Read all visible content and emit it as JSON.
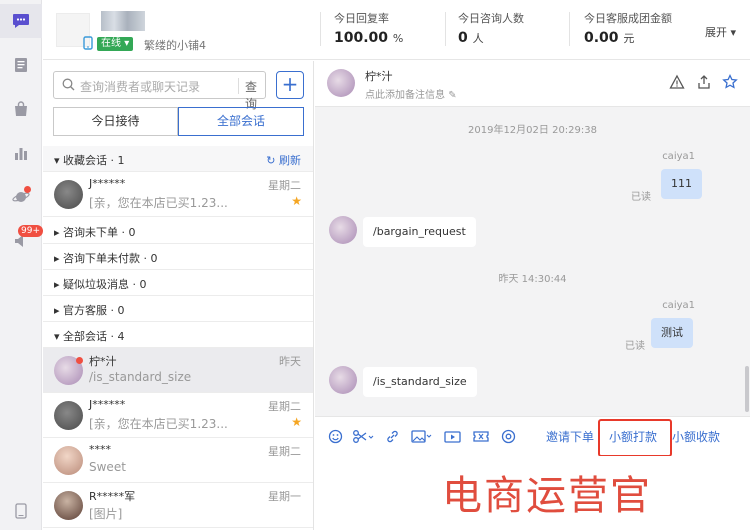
{
  "sidebar": {
    "badge_count": "99+"
  },
  "topbar": {
    "status": "在线",
    "shop_name": "繁缕的小铺4",
    "stats": [
      {
        "label": "今日回复率",
        "value": "100.00",
        "unit": "%"
      },
      {
        "label": "今日咨询人数",
        "value": "0",
        "unit": "人"
      },
      {
        "label": "今日客服成团金额",
        "value": "0.00",
        "unit": "元"
      }
    ],
    "expand": "展开"
  },
  "search": {
    "placeholder": "查询消费者或聊天记录",
    "button": "查询"
  },
  "tabs": {
    "today": "今日接待",
    "all": "全部会话"
  },
  "groups": {
    "fav": "收藏会话 · 1",
    "refresh": "刷新",
    "unordered": "咨询未下单 · 0",
    "unpaid": "咨询下单未付款 · 0",
    "spam": "疑似垃圾消息 · 0",
    "official": "官方客服 · 0",
    "all": "全部会话 · 4"
  },
  "fav_conv": {
    "name": "J******",
    "msg": "[亲，您在本店已买1.23...",
    "time": "星期二"
  },
  "all_convs": [
    {
      "name": "柠*汁",
      "msg": "/is_standard_size",
      "time": "昨天"
    },
    {
      "name": "J******",
      "msg": "[亲，您在本店已买1.23...",
      "time": "星期二"
    },
    {
      "name": "****",
      "msg": "Sweet",
      "time": "星期二"
    },
    {
      "name": "R*****军",
      "msg": "[图片]",
      "time": "星期一"
    }
  ],
  "chat": {
    "name": "柠*汁",
    "note": "点此添加备注信息",
    "messages": {
      "ts1": "2019年12月02日 20:29:38",
      "sender": "caiya1",
      "m1": "111",
      "read": "已读",
      "m2": "/bargain_request",
      "ts2": "昨天 14:30:44",
      "m3": "测试",
      "m4": "/is_standard_size"
    },
    "actions": {
      "invite": "邀请下单",
      "small_pay": "小额打款",
      "small_collect": "小额收款"
    }
  },
  "watermark": "电商运营官",
  "colors": {
    "accent": "#3a6fcf",
    "highlight": "#e8392a",
    "online": "#33a856"
  }
}
